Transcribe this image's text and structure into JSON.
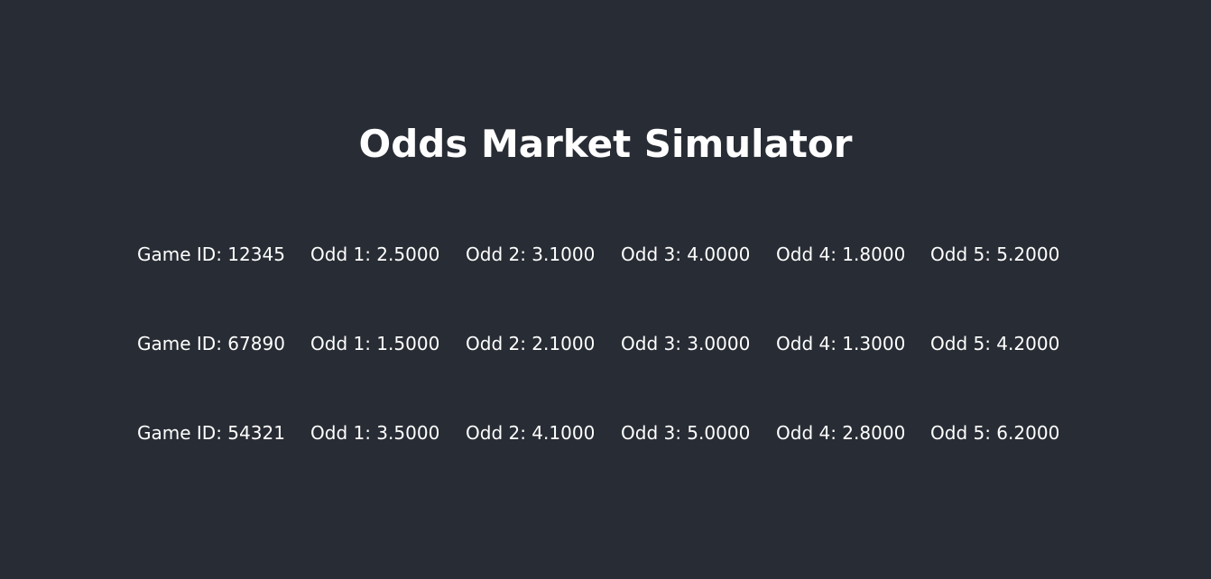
{
  "page": {
    "title": "Odds Market Simulator",
    "background_color": "#282c34",
    "text_color": "#ffffff"
  },
  "games": [
    {
      "game_id": "Game ID: 12345",
      "odds": [
        "Odd 1: 2.5000",
        "Odd 2: 3.1000",
        "Odd 3: 4.0000",
        "Odd 4: 1.8000",
        "Odd 5: 5.2000"
      ]
    },
    {
      "game_id": "Game ID: 67890",
      "odds": [
        "Odd 1: 1.5000",
        "Odd 2: 2.1000",
        "Odd 3: 3.0000",
        "Odd 4: 1.3000",
        "Odd 5: 4.2000"
      ]
    },
    {
      "game_id": "Game ID: 54321",
      "odds": [
        "Odd 1: 3.5000",
        "Odd 2: 4.1000",
        "Odd 3: 5.0000",
        "Odd 4: 2.8000",
        "Odd 5: 6.2000"
      ]
    }
  ]
}
